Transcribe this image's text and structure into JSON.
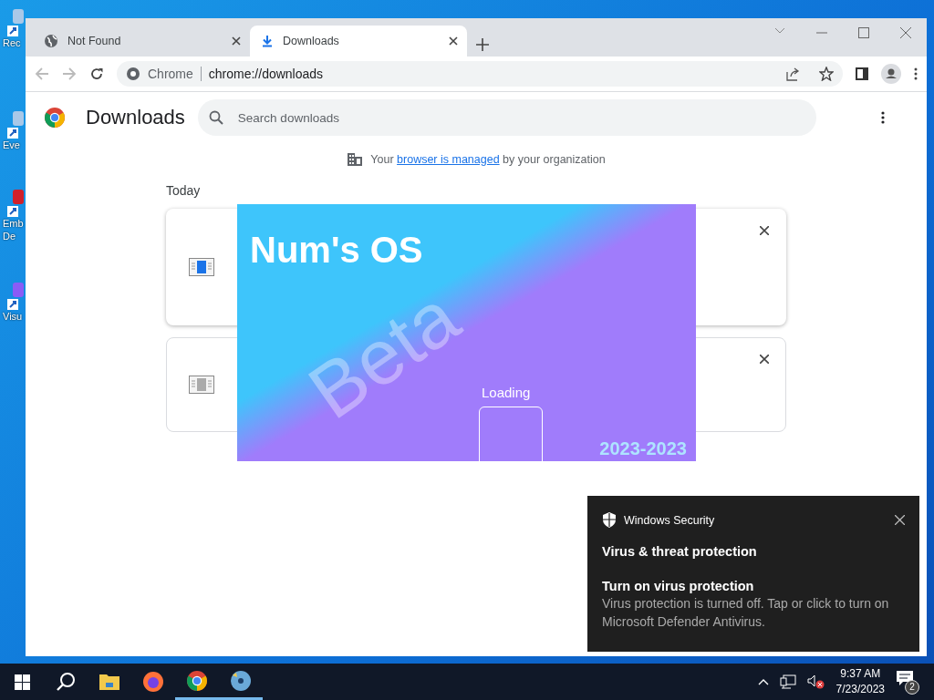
{
  "desktop_icons": [
    {
      "lines": [
        "Rec"
      ]
    },
    {
      "lines": [
        "Eve"
      ]
    },
    {
      "lines": [
        "Emb",
        "De"
      ]
    },
    {
      "lines": [
        "Visu"
      ]
    }
  ],
  "browser": {
    "tabs": [
      {
        "title": "Not Found",
        "selected": false,
        "kind": "globe"
      },
      {
        "title": "Downloads",
        "selected": true,
        "kind": "download"
      }
    ],
    "address": {
      "origin": "Chrome",
      "url": "chrome://downloads"
    },
    "page": {
      "title": "Downloads",
      "search": {
        "placeholder": "Search downloads"
      },
      "managed": {
        "before": "Your",
        "link": "browser is managed",
        "after": "by your organization"
      },
      "section": "Today",
      "downloads": [
        {
          "raised": true,
          "dimmed": false
        },
        {
          "raised": false,
          "dimmed": true
        }
      ]
    }
  },
  "splash": {
    "title": "Num's OS",
    "watermark": "Beta",
    "status": "Loading",
    "years": "2023-2023"
  },
  "toast": {
    "app": "Windows Security",
    "heading": "Virus & threat protection",
    "title": "Turn on virus protection",
    "body": "Virus protection is turned off. Tap or click to turn on Microsoft Defender Antivirus."
  },
  "taskbar": {
    "apps": [
      {
        "kind": "folder",
        "active": false
      },
      {
        "kind": "firefox",
        "active": false
      },
      {
        "kind": "chrome",
        "active": true
      },
      {
        "kind": "disc",
        "active": true
      }
    ],
    "time": "9:37 AM",
    "date": "7/23/2023",
    "notifications": "2"
  }
}
